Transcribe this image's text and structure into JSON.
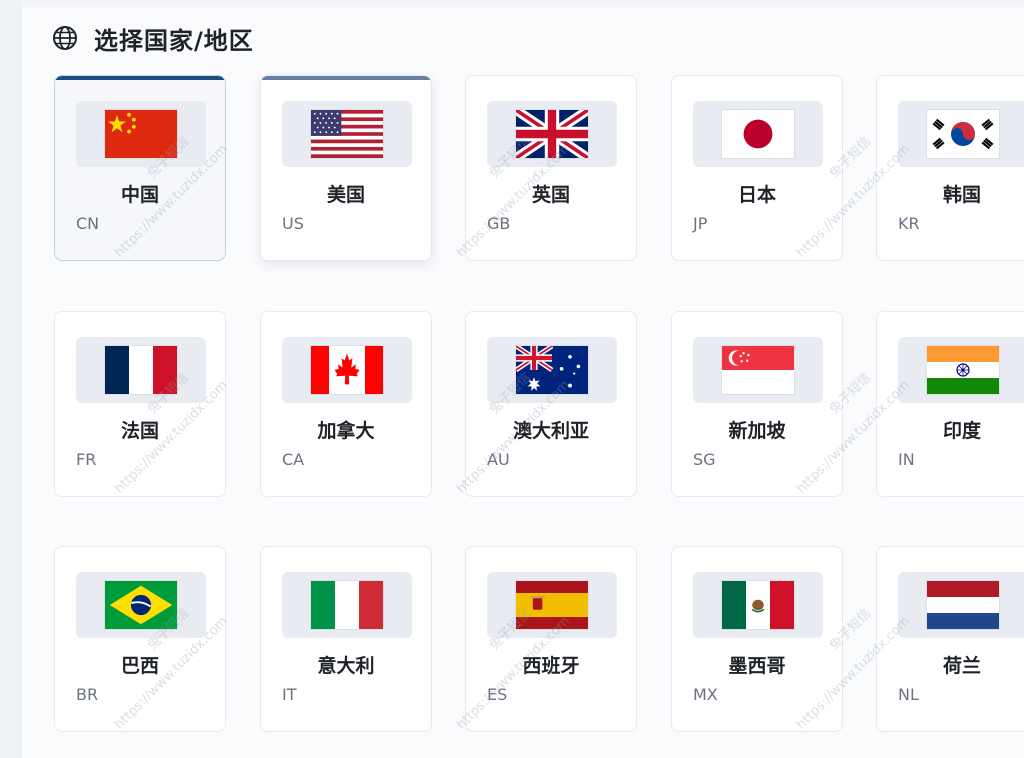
{
  "section": {
    "title": "选择国家/地区",
    "icon": "globe-icon"
  },
  "countries": [
    {
      "name": "中国",
      "code": "CN",
      "selected": true
    },
    {
      "name": "美国",
      "code": "US"
    },
    {
      "name": "英国",
      "code": "GB"
    },
    {
      "name": "日本",
      "code": "JP"
    },
    {
      "name": "韩国",
      "code": "KR"
    },
    {
      "name": "法国",
      "code": "FR"
    },
    {
      "name": "加拿大",
      "code": "CA"
    },
    {
      "name": "澳大利亚",
      "code": "AU"
    },
    {
      "name": "新加坡",
      "code": "SG"
    },
    {
      "name": "印度",
      "code": "IN"
    },
    {
      "name": "巴西",
      "code": "BR"
    },
    {
      "name": "意大利",
      "code": "IT"
    },
    {
      "name": "西班牙",
      "code": "ES"
    },
    {
      "name": "墨西哥",
      "code": "MX"
    },
    {
      "name": "荷兰",
      "code": "NL"
    }
  ],
  "watermark": {
    "brand": "兔子短信",
    "url": "https://www.tuzidx.com"
  },
  "colors": {
    "selected_accent": "#1e4f84",
    "hover_accent": "#6a80a3"
  }
}
